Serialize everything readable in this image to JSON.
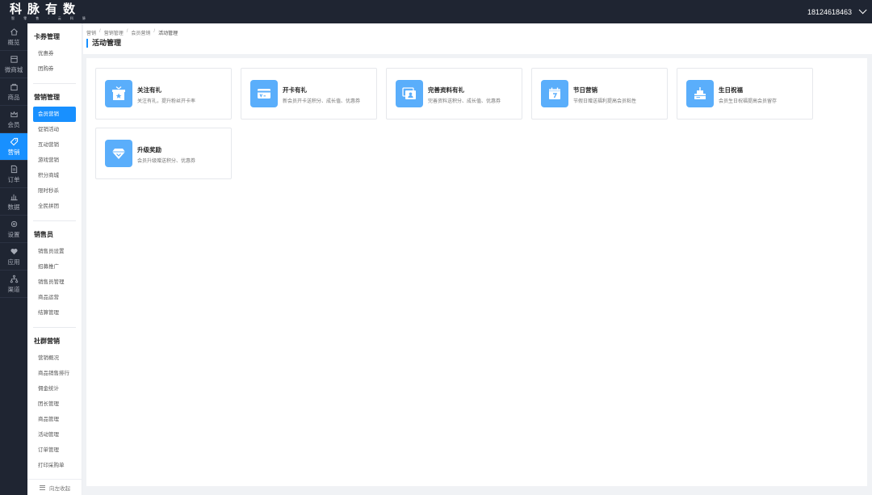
{
  "brand": {
    "name": "科脉有数",
    "tagline": "智 零 售 · 云 科 脉"
  },
  "user": {
    "account": "18124618463"
  },
  "rail": [
    {
      "label": "概览",
      "icon": "home-icon"
    },
    {
      "label": "微商城",
      "icon": "shop-icon"
    },
    {
      "label": "商品",
      "icon": "bag-icon"
    },
    {
      "label": "会员",
      "icon": "crown-icon"
    },
    {
      "label": "营销",
      "icon": "tag-icon",
      "active": true
    },
    {
      "label": "订单",
      "icon": "document-icon"
    },
    {
      "label": "数据",
      "icon": "bar-chart-icon"
    },
    {
      "label": "设置",
      "icon": "gear-icon"
    },
    {
      "label": "应用",
      "icon": "heart-icon"
    },
    {
      "label": "渠道",
      "icon": "network-icon"
    }
  ],
  "sidebar": {
    "groups": [
      {
        "title": "卡券管理",
        "items": [
          "优惠券",
          "团购券"
        ]
      },
      {
        "title": "营销管理",
        "items": [
          "会员营销",
          "促销活动",
          "互动营销",
          "游戏营销",
          "积分商城",
          "限时秒杀",
          "全民拼团"
        ],
        "active": 0
      },
      {
        "title": "销售员",
        "items": [
          "销售员设置",
          "招募推广",
          "销售员管理",
          "商品运营",
          "结算管理"
        ]
      },
      {
        "title": "社群营销",
        "items": [
          "营销概况",
          "商品销售排行",
          "佣金统计",
          "团长管理",
          "商品管理",
          "活动管理",
          "订单管理",
          "打印采购单"
        ]
      }
    ],
    "collapse_label": "向左收起"
  },
  "breadcrumb": [
    "营销",
    "营销管理",
    "会员营销",
    "活动管理"
  ],
  "page_title": "活动管理",
  "cards": [
    {
      "title": "关注有礼",
      "desc": "关注有礼，提升粉丝开卡率",
      "icon": "gift-icon"
    },
    {
      "title": "开卡有礼",
      "desc": "新会员开卡送积分、成长值、优惠券",
      "icon": "card-icon"
    },
    {
      "title": "完善资料有礼",
      "desc": "完善资料送积分、成长值、优惠券",
      "icon": "profile-icon"
    },
    {
      "title": "节日营销",
      "desc": "节假日赠送福利提高会员粘性",
      "icon": "calendar-icon"
    },
    {
      "title": "生日祝福",
      "desc": "会员生日祝福提高会员留存",
      "icon": "cake-icon"
    },
    {
      "title": "升级奖励",
      "desc": "会员升级赠送积分、优惠券",
      "icon": "diamond-icon"
    }
  ],
  "colors": {
    "accent": "#1890ff",
    "topbar": "#1f2532",
    "card_icon_bg": "#5aaefb"
  }
}
